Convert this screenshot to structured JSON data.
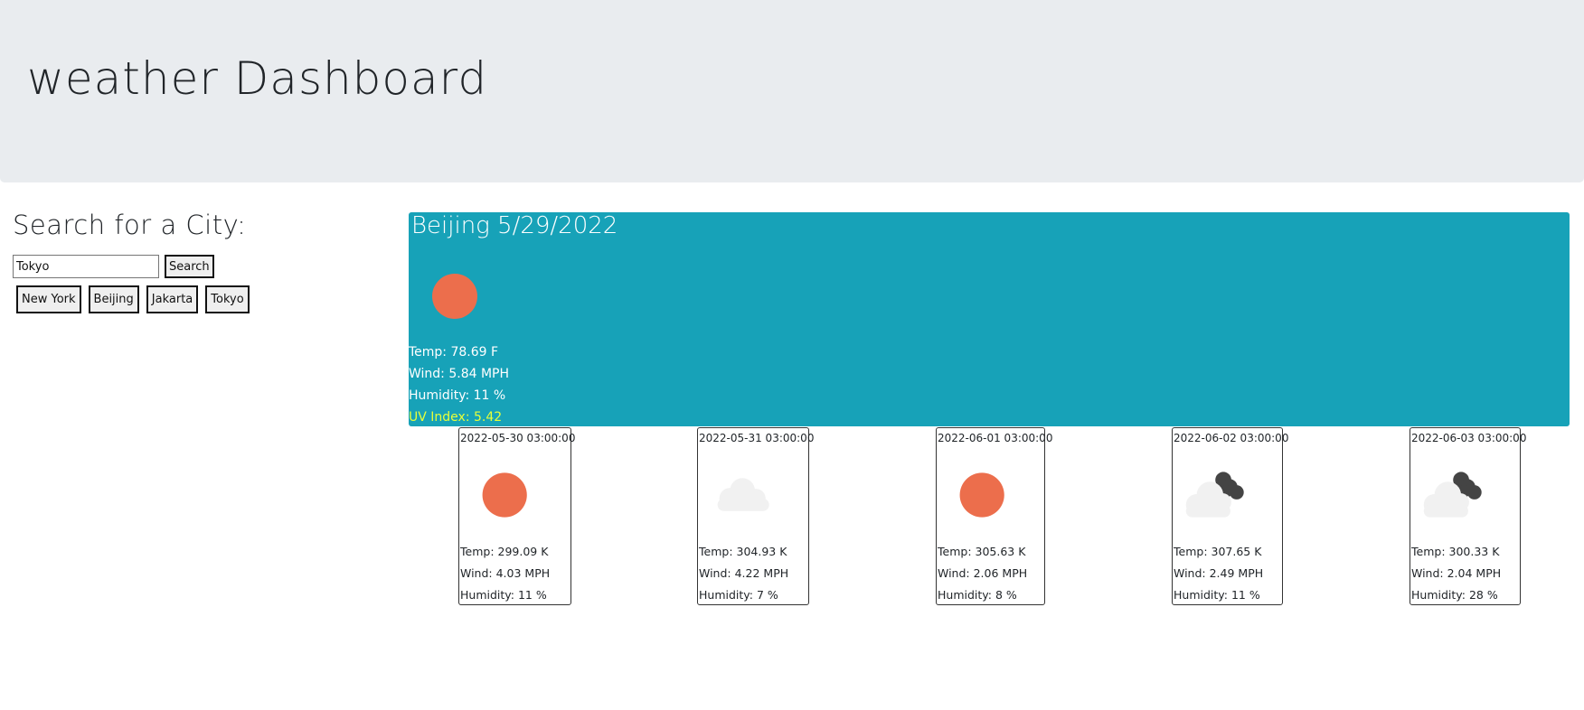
{
  "header": {
    "title": "weather Dashboard"
  },
  "search": {
    "heading": "Search for a City:",
    "input_value": "Tokyo",
    "button_label": "Search",
    "history": [
      "New York",
      "Beijing",
      "Jakarta",
      "Tokyo"
    ]
  },
  "current": {
    "title": "Beijing 5/29/2022",
    "icon": "sun-icon",
    "temp": "Temp: 78.69 F",
    "wind": "Wind: 5.84 MPH",
    "humidity": "Humidity: 11 %",
    "uv": "UV Index: 5.42"
  },
  "forecast": [
    {
      "date": "2022-05-30 03:00:00",
      "icon": "sun-icon",
      "temp": "Temp: 299.09 K",
      "wind": "Wind: 4.03 MPH",
      "humidity": "Humidity: 11 %"
    },
    {
      "date": "2022-05-31 03:00:00",
      "icon": "cloud-icon",
      "temp": "Temp: 304.93 K",
      "wind": "Wind: 4.22 MPH",
      "humidity": "Humidity: 7 %"
    },
    {
      "date": "2022-06-01 03:00:00",
      "icon": "sun-icon",
      "temp": "Temp: 305.63 K",
      "wind": "Wind: 2.06 MPH",
      "humidity": "Humidity: 8 %"
    },
    {
      "date": "2022-06-02 03:00:00",
      "icon": "broken-clouds-icon",
      "temp": "Temp: 307.65 K",
      "wind": "Wind: 2.49 MPH",
      "humidity": "Humidity: 11 %"
    },
    {
      "date": "2022-06-03 03:00:00",
      "icon": "broken-clouds-icon",
      "temp": "Temp: 300.33 K",
      "wind": "Wind: 2.04 MPH",
      "humidity": "Humidity: 28 %"
    }
  ],
  "colors": {
    "header_bg": "#e9ecef",
    "current_bg": "#17a2b8",
    "sun": "#ec6e4c",
    "uv_text": "#e6ff3a"
  }
}
